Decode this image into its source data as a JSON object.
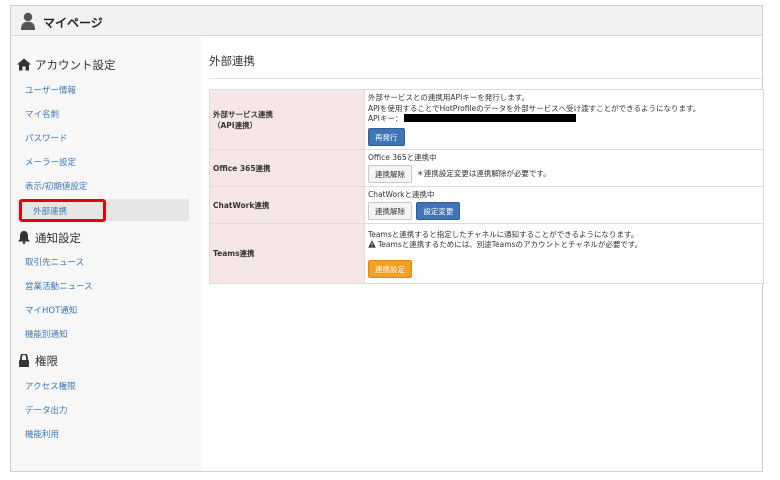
{
  "header": {
    "title": "マイページ"
  },
  "sidebar": {
    "sections": [
      {
        "label": "アカウント設定",
        "items": [
          {
            "label": "ユーザー情報"
          },
          {
            "label": "マイ名刺"
          },
          {
            "label": "パスワード"
          },
          {
            "label": "メーラー設定"
          },
          {
            "label": "表示/初期値設定"
          },
          {
            "label": "外部連携",
            "active": true
          }
        ]
      },
      {
        "label": "通知設定",
        "items": [
          {
            "label": "取引先ニュース"
          },
          {
            "label": "営業活動ニュース"
          },
          {
            "label": "マイHOT通知"
          },
          {
            "label": "機能別通知"
          }
        ]
      },
      {
        "label": "権限",
        "items": [
          {
            "label": "アクセス権限"
          },
          {
            "label": "データ出力"
          },
          {
            "label": "機能利用"
          }
        ]
      }
    ]
  },
  "content": {
    "title": "外部連携",
    "rows": {
      "api": {
        "label_line1": "外部サービス連携",
        "label_line2": "（API連携）",
        "desc1": "外部サービスとの連携用APIキーを発行します。",
        "desc2": "APIを使用することでHotProfileのデータを外部サービスへ受け渡すことができるようになります。",
        "key_label": "APIキー：",
        "reissue_button": "再発行"
      },
      "office365": {
        "label": "Office 365連携",
        "status": "Office 365と連携中",
        "unlink_button": "連携解除",
        "note": "＊連携設定変更は連携解除が必要です。"
      },
      "chatwork": {
        "label": "ChatWork連携",
        "status": "ChatWorkと連携中",
        "unlink_button": "連携解除",
        "settings_button": "設定変更"
      },
      "teams": {
        "label": "Teams連携",
        "desc1": "Teamsと連携すると指定したチャネルに通知することができるようになります。",
        "desc2": "Teamsと連携するためには、別途Teamsのアカウントとチャネルが必要です。",
        "link_button": "連携設定"
      }
    }
  },
  "colors": {
    "link": "#3a7ab8",
    "label_bg": "#f6e6e7",
    "primary_button": "#3f74b6",
    "warning_button": "#f2a020",
    "highlight": "#e8000b"
  }
}
